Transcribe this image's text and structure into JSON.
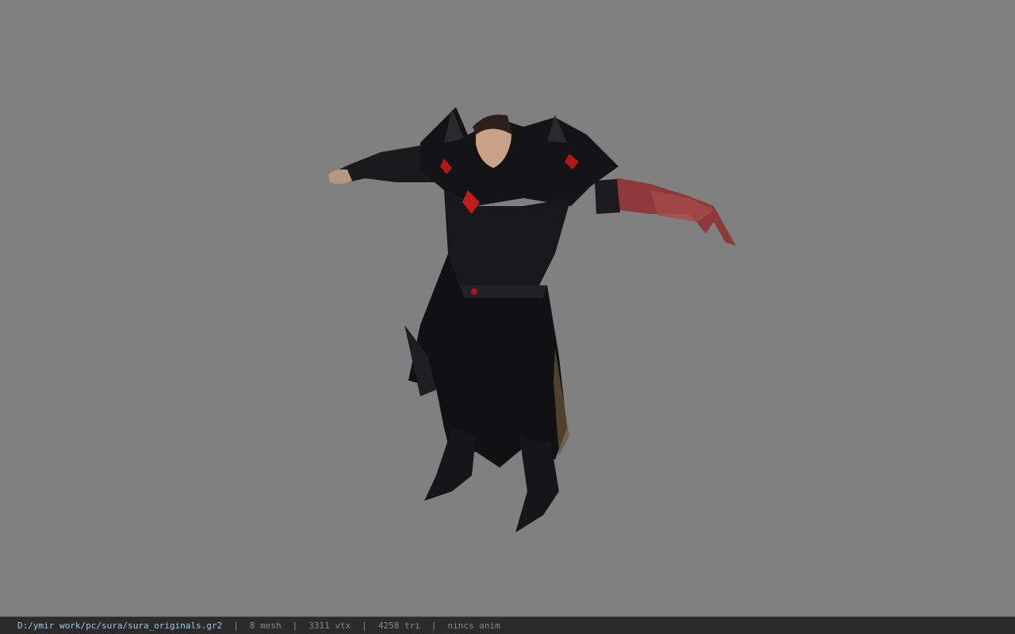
{
  "status_bar": {
    "file_path": "D:/ymir work/pc/sura/sura_originals.gr2",
    "separator": "|",
    "mesh_count": "8 mesh",
    "vertex_count": "3311 vtx",
    "triangle_count": "4258 tri",
    "animation": "nincs anim"
  },
  "colors": {
    "viewport_background": "#808080",
    "statusbar_background": "#2b2b2b",
    "path_text": "#9fc9e6",
    "stat_text": "#8a8a8a"
  },
  "viewport": {
    "model_icon": "sura-character-model"
  }
}
